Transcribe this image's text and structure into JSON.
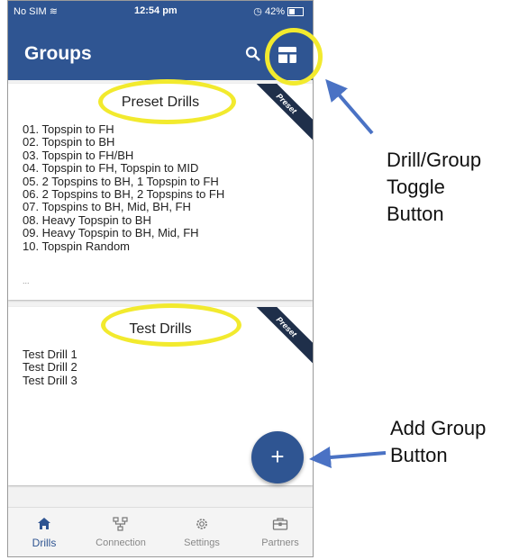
{
  "status_bar": {
    "carrier": "No SIM",
    "time": "12:54 pm",
    "battery": "42%"
  },
  "header": {
    "title": "Groups"
  },
  "groups": [
    {
      "title": "Preset Drills",
      "ribbon": "Preset",
      "items": [
        "01. Topspin to FH",
        "02. Topspin to BH",
        "03. Topspin to FH/BH",
        "04. Topspin to FH, Topspin to MID",
        "05. 2 Topspins to BH, 1 Topspin to FH",
        "06. 2 Topspins to BH, 2 Topspins to FH",
        "07. Topspins to BH, Mid, BH, FH",
        "08. Heavy Topspin to BH",
        "09. Heavy Topspin to BH, Mid, FH",
        "10. Topspin Random"
      ],
      "more": "..."
    },
    {
      "title": "Test Drills",
      "ribbon": "Preset",
      "items": [
        "Test Drill 1",
        "Test Drill 2",
        "Test Drill 3"
      ]
    }
  ],
  "fab": {
    "label": "+"
  },
  "tabs": [
    {
      "label": "Drills",
      "icon": "home-icon",
      "active": true
    },
    {
      "label": "Connection",
      "icon": "connection-icon",
      "active": false
    },
    {
      "label": "Settings",
      "icon": "gear-icon",
      "active": false
    },
    {
      "label": "Partners",
      "icon": "briefcase-icon",
      "active": false
    }
  ],
  "annotations": {
    "toggle": [
      "Drill/Group",
      "Toggle",
      "Button"
    ],
    "add": [
      "Add Group",
      "Button"
    ]
  },
  "colors": {
    "primary": "#2f5592",
    "highlight": "#f2ea2e",
    "arrow": "#4a72c4",
    "ribbon": "#1f2f4a"
  }
}
